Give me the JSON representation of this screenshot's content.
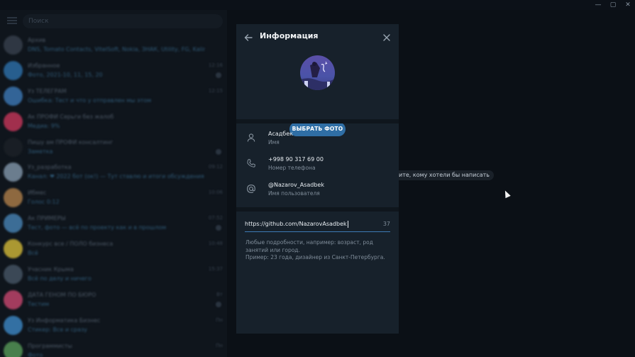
{
  "window": {
    "controls": {
      "minimize": "—",
      "maximize": "▢",
      "close": "✕"
    }
  },
  "sidebar": {
    "search_placeholder": "Поиск",
    "chats": [
      {
        "title": "Архив",
        "preview": "DNS, Tomato Contacts, VitelSoft, Nokia, ЗНАК, Utility, FG, Kalinin",
        "time": "",
        "avatar_color": "#3a4350"
      },
      {
        "title": "Избранное",
        "preview": "Фото, 2021-10, 11, 15, 20",
        "time": "12:16",
        "avatar_color": "#2f77b5"
      },
      {
        "title": "Уз ТЕЛЕГРАМ",
        "preview": "Ошибка: Тест и что у отправлен мы этом",
        "time": "12:15",
        "avatar_color": "#3f7fc0"
      },
      {
        "title": "Ак ПРОФИ Серьги без жалоб",
        "preview": "Медиа: 9%",
        "time": "",
        "avatar_color": "#d2385e"
      },
      {
        "title": "Пишу ам ПРОФИ консалтинг",
        "preview": "Заметка",
        "time": "",
        "avatar_color": "#1d2228"
      },
      {
        "title": "Уз_разработка",
        "preview": "Канал: ❤ 2022 бот (ок!) — Тут ставлю и итоги обсуждения",
        "time": "09:12",
        "avatar_color": "#8aa0b5"
      },
      {
        "title": "Ибмес",
        "preview": "Голос 0:12",
        "time": "10:06",
        "avatar_color": "#b9864d"
      },
      {
        "title": "Ак ПРИМЕРЫ",
        "preview": "Тест, фото — всё по проекту как и в прошлом",
        "time": "07:52",
        "avatar_color": "#4b8bbf"
      },
      {
        "title": "Конкурс все / ПОЛО бизнеса",
        "preview": "Всё",
        "time": "10:48",
        "avatar_color": "#e0c43a"
      },
      {
        "title": "Учасник Крыма",
        "preview": "Всё по делу и ничего",
        "time": "15:37",
        "avatar_color": "#4a5a6a"
      },
      {
        "title": "ДАТА ГЕНОМ ПО БЮРО",
        "preview": "Тестим",
        "time": "Вт",
        "avatar_color": "#d44a74"
      },
      {
        "title": "Уз Информатика Бизнес",
        "preview": "Стикер: Все и сразу",
        "time": "Пн",
        "avatar_color": "#3f8fd0"
      },
      {
        "title": "Программисты",
        "preview": "Фото",
        "time": "Пн",
        "avatar_color": "#5ca35c"
      }
    ]
  },
  "main": {
    "empty_hint": "ите, кому хотели бы написать"
  },
  "modal": {
    "title": "Информация",
    "choose_photo_label": "ВЫБРАТЬ ФОТО",
    "info_rows": [
      {
        "icon": "user-icon",
        "value": "Асадбек",
        "label": "Имя"
      },
      {
        "icon": "phone-icon",
        "value": "+998 90 317 69 00",
        "label": "Номер телефона"
      },
      {
        "icon": "at-icon",
        "value": "@Nazarov_Asadbek",
        "label": "Имя пользователя"
      }
    ],
    "bio": {
      "value": "https://github.com/NazarovAsadbek",
      "counter": "37",
      "hint_line1": "Любые подробности, например: возраст, род занятий или город.",
      "hint_line2": "Пример: 23 года, дизайнер из Санкт-Петербурга."
    }
  },
  "colors": {
    "modal_bg": "#17212b",
    "accent": "#2f6ea5",
    "underline": "#3d7ab5",
    "secondary_text": "#7f8c99"
  }
}
